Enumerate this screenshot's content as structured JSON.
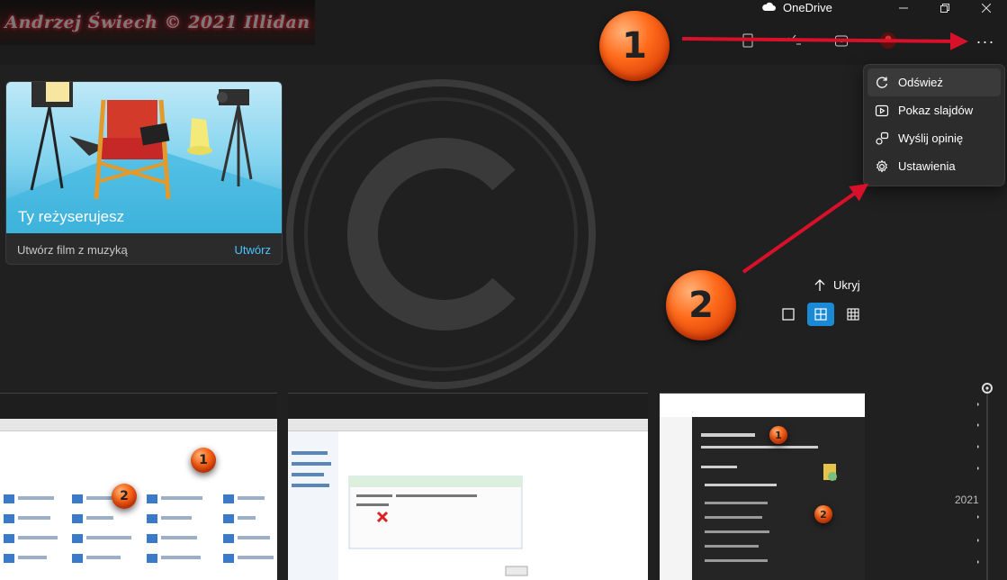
{
  "watermark": {
    "text": "Andrzej Świech © 2021 Illidan"
  },
  "app": {
    "title": "OneDrive"
  },
  "toolbar": {
    "more_label": "···"
  },
  "annotations": {
    "badge1": "1",
    "badge2": "2"
  },
  "card": {
    "title": "Ty reżyserujesz",
    "subtitle": "Utwórz film z muzyką",
    "action": "Utwórz"
  },
  "menu": {
    "items": [
      {
        "label": "Odśwież",
        "icon": "refresh-icon"
      },
      {
        "label": "Pokaz slajdów",
        "icon": "slideshow-icon"
      },
      {
        "label": "Wyślij opinię",
        "icon": "feedback-icon"
      },
      {
        "label": "Ustawienia",
        "icon": "gear-icon"
      }
    ]
  },
  "view": {
    "hide_label": "Ukryj"
  },
  "timeline": {
    "year": "2021"
  },
  "thumbnails": {
    "t1": {
      "badge1": "1",
      "badge2": "2"
    },
    "t3": {
      "badge1": "1",
      "badge2": "2"
    }
  },
  "colors": {
    "accent": "#1a8ad4",
    "link": "#4cc2ff",
    "badge": "#ff6a1a",
    "arrow": "#d8102a"
  }
}
